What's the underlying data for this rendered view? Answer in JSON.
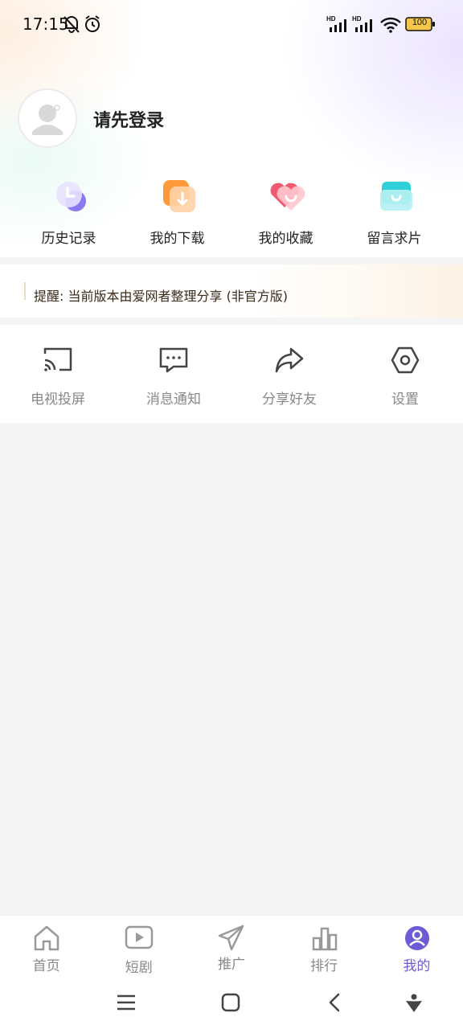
{
  "status_bar": {
    "time": "17:15",
    "battery": "100",
    "network_label": "HD",
    "icons": [
      "bell-off-icon",
      "alarm-icon",
      "signal-hd-icon",
      "signal-hd-icon",
      "wifi-icon",
      "battery-icon"
    ]
  },
  "profile": {
    "login_prompt": "请先登录"
  },
  "quick_actions": [
    {
      "label": "历史记录",
      "icon": "history-icon",
      "color": "#8a78f0"
    },
    {
      "label": "我的下载",
      "icon": "download-icon",
      "color": "#ff9a3c"
    },
    {
      "label": "我的收藏",
      "icon": "heart-icon",
      "color": "#f05a6e"
    },
    {
      "label": "留言求片",
      "icon": "message-box-icon",
      "color": "#2fd0d8"
    }
  ],
  "notice": {
    "text": "提醒: 当前版本由爱网者整理分享 (非官方版)"
  },
  "tools": [
    {
      "label": "电视投屏",
      "icon": "cast-icon"
    },
    {
      "label": "消息通知",
      "icon": "chat-icon"
    },
    {
      "label": "分享好友",
      "icon": "share-icon"
    },
    {
      "label": "设置",
      "icon": "settings-icon"
    }
  ],
  "bottom_nav": [
    {
      "label": "首页",
      "icon": "home-icon",
      "active": false
    },
    {
      "label": "短剧",
      "icon": "play-icon",
      "active": false
    },
    {
      "label": "推广",
      "icon": "send-icon",
      "active": false
    },
    {
      "label": "排行",
      "icon": "bar-chart-icon",
      "active": false
    },
    {
      "label": "我的",
      "icon": "user-icon",
      "active": true
    }
  ],
  "colors": {
    "accent": "#6b5bd6",
    "inactive": "#888888"
  }
}
